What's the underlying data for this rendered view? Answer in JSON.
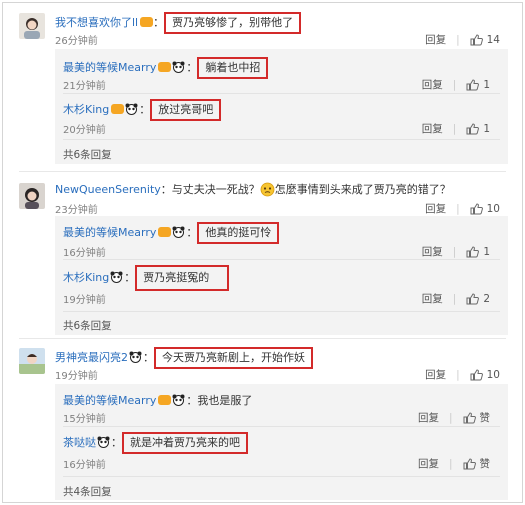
{
  "comments": [
    {
      "name": "我不想喜欢你了ll",
      "text": "贾乃亮够惨了，别带他了",
      "time": "26分钟前",
      "reply_label": "回复",
      "likes": "14",
      "replies": [
        {
          "name": "最美的等候Mearry",
          "text": "躺着也中招",
          "time": "21分钟前",
          "reply_label": "回复",
          "likes": "1"
        },
        {
          "name": "木杉King",
          "text": "放过亮哥吧",
          "time": "20分钟前",
          "reply_label": "回复",
          "likes": "1"
        }
      ],
      "more": "共6条回复"
    },
    {
      "name": "NewQueenSerenity",
      "text_pre": "：与丈夫决一死战？",
      "text_post": "怎麼事情到头来成了贾乃亮的错了？",
      "time": "23分钟前",
      "reply_label": "回复",
      "likes": "10",
      "replies": [
        {
          "name": "最美的等候Mearry",
          "text": "他真的挺可怜",
          "time": "16分钟前",
          "reply_label": "回复",
          "likes": "1"
        },
        {
          "name": "木杉King",
          "text": "贾乃亮挺冤的",
          "time": "19分钟前",
          "reply_label": "回复",
          "likes": "2"
        }
      ],
      "more": "共6条回复"
    },
    {
      "name": "男神亮最闪亮2",
      "text": "今天贾乃亮新剧上，开始作妖",
      "time": "19分钟前",
      "reply_label": "回复",
      "likes": "10",
      "replies": [
        {
          "name": "最美的等候Mearry",
          "text": "：我也是服了",
          "time": "15分钟前",
          "reply_label": "回复",
          "likes": "赞"
        },
        {
          "name": "茶哒哒",
          "text": "就是冲着贾乃亮来的吧",
          "time": "16分钟前",
          "reply_label": "回复",
          "likes": "赞"
        }
      ],
      "more": "共4条回复"
    }
  ],
  "colors": {
    "highlight": "#d32a2a",
    "name": "#eb7350",
    "link": "#2a6ebd"
  }
}
